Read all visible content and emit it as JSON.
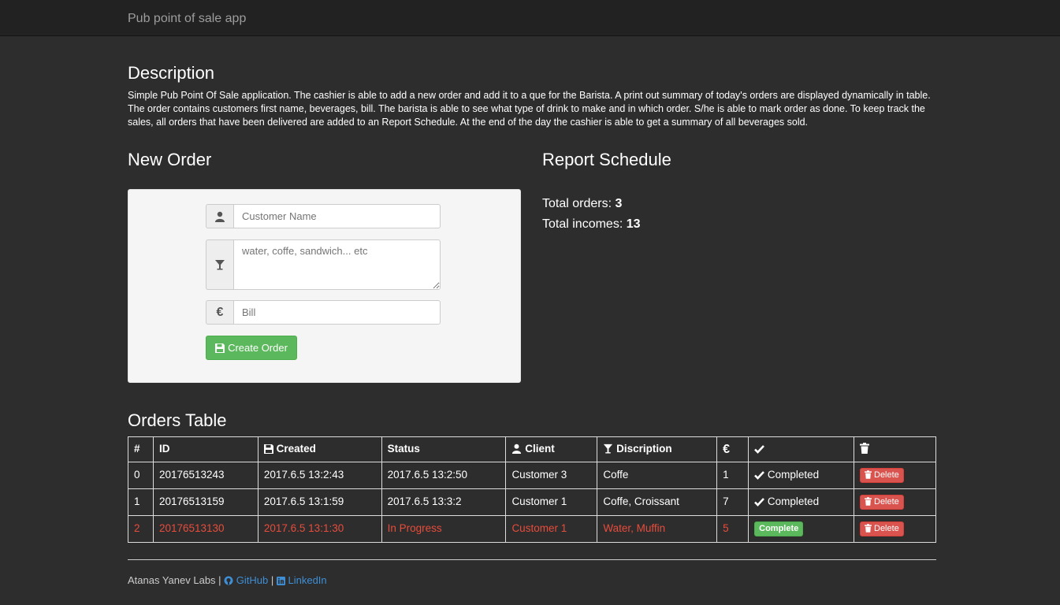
{
  "app": {
    "title": "Pub point of sale app"
  },
  "description": {
    "title": "Description",
    "text": "Simple Pub Point Of Sale application. The cashier is able to add a new order and add it to a que for the Barista. A print out summary of today's orders are displayed dynamically in table. The order contains customers first name, beverages, bill. The barista is able to see what type of drink to make and in which order. S/he is able to mark order as done. To keep track the sales, all orders that have been delivered are added to an Report Schedule. At the end of the day the cashier is able to get a summary of all beverages sold."
  },
  "new_order": {
    "title": "New Order",
    "customer_placeholder": "Customer Name",
    "beverages_placeholder": "water, coffe, sandwich... etc",
    "bill_placeholder": "Bill",
    "bill_icon": "€",
    "create_label": "Create Order"
  },
  "report": {
    "title": "Report Schedule",
    "orders_label": "Total orders: ",
    "orders_value": "3",
    "incomes_label": "Total incomes: ",
    "incomes_value": "13"
  },
  "orders_table": {
    "title": "Orders Table",
    "headers": {
      "num": "#",
      "id": "ID",
      "created": "Created",
      "status": "Status",
      "client": "Client",
      "description": "Discription",
      "euro": "€"
    },
    "rows": [
      {
        "num": "0",
        "id": "20176513243",
        "created": "2017.6.5 13:2:43",
        "status": "2017.6.5 13:2:50",
        "client": "Customer 3",
        "description": "Coffe",
        "bill": "1",
        "state": "Completed",
        "delete": "Delete"
      },
      {
        "num": "1",
        "id": "20176513159",
        "created": "2017.6.5 13:1:59",
        "status": "2017.6.5 13:3:2",
        "client": "Customer 1",
        "description": "Coffe, Croissant",
        "bill": "7",
        "state": "Completed",
        "delete": "Delete"
      },
      {
        "num": "2",
        "id": "20176513130",
        "created": "2017.6.5 13:1:30",
        "status": "In Progress",
        "client": "Customer 1",
        "description": "Water, Muffin",
        "bill": "5",
        "state": "Complete",
        "delete": "Delete"
      }
    ]
  },
  "footer": {
    "author": "Atanas Yanev Labs | ",
    "separator": " | ",
    "github": "GitHub",
    "linkedin": "LinkedIn"
  },
  "colors": {
    "background": "#2d2d2d",
    "navbar": "#222222",
    "success": "#5cb85c",
    "danger": "#d9534f",
    "in_progress": "#e74c3c",
    "link": "#3e8fd6"
  }
}
